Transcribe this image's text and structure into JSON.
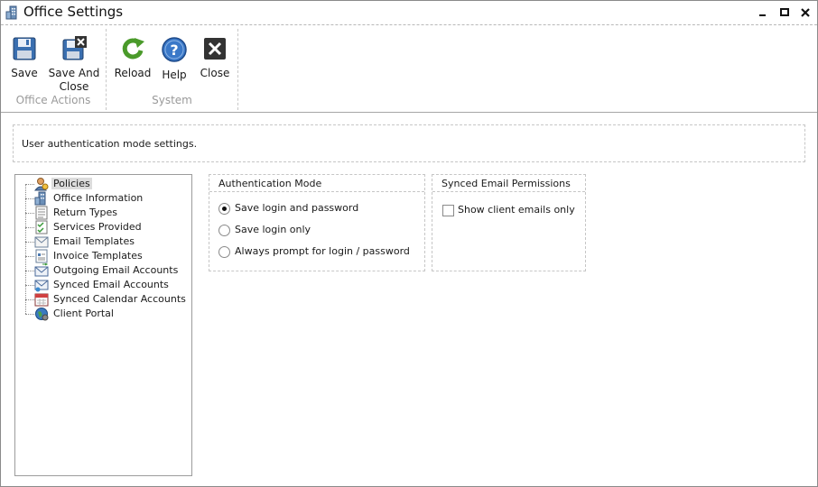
{
  "window": {
    "title": "Office Settings"
  },
  "ribbon": {
    "groups": [
      {
        "label": "Office Actions",
        "buttons": [
          {
            "label": "Save",
            "icon": "floppy-disk-icon"
          },
          {
            "label": "Save And Close",
            "icon": "save-close-icon"
          }
        ]
      },
      {
        "label": "System",
        "buttons": [
          {
            "label": "Reload",
            "icon": "reload-icon"
          },
          {
            "label": "Help",
            "icon": "help-icon"
          },
          {
            "label": "Close",
            "icon": "close-icon"
          }
        ]
      }
    ]
  },
  "info": {
    "text": "User authentication mode settings."
  },
  "tree": {
    "items": [
      {
        "label": "Policies",
        "icon": "policies-icon",
        "selected": true
      },
      {
        "label": "Office Information",
        "icon": "building-icon"
      },
      {
        "label": "Return Types",
        "icon": "document-list-icon"
      },
      {
        "label": "Services Provided",
        "icon": "checklist-icon"
      },
      {
        "label": "Email Templates",
        "icon": "email-template-icon"
      },
      {
        "label": "Invoice Templates",
        "icon": "invoice-icon"
      },
      {
        "label": "Outgoing Email Accounts",
        "icon": "outgoing-mail-icon"
      },
      {
        "label": "Synced Email Accounts",
        "icon": "synced-mail-icon"
      },
      {
        "label": "Synced Calendar Accounts",
        "icon": "calendar-icon"
      },
      {
        "label": "Client Portal",
        "icon": "globe-icon"
      }
    ]
  },
  "auth": {
    "title": "Authentication Mode",
    "options": [
      {
        "label": "Save login and password",
        "checked": true
      },
      {
        "label": "Save login only",
        "checked": false
      },
      {
        "label": "Always prompt for login / password",
        "checked": false
      }
    ]
  },
  "synced": {
    "title": "Synced Email Permissions",
    "show_client_emails_label": "Show client emails only",
    "show_client_emails_checked": false
  },
  "colors": {
    "accent_blue": "#3a6fb0",
    "reload_green": "#4a9a2a",
    "close_dark": "#333333"
  }
}
